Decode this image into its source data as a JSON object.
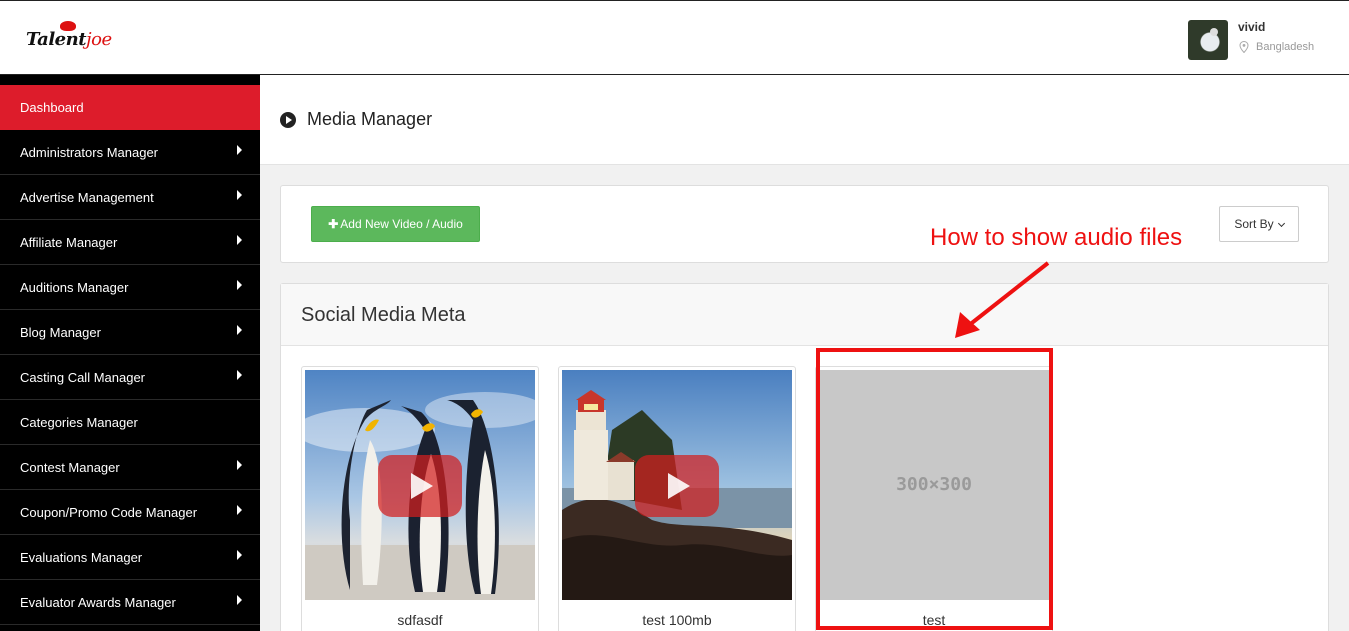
{
  "header": {
    "logo_main": "Talent",
    "logo_accent": "joe",
    "user": {
      "name": "vivid",
      "location": "Bangladesh",
      "avatar_icon": "user-avatar"
    }
  },
  "sidebar": {
    "items": [
      {
        "label": "Dashboard",
        "active": true,
        "has_submenu": false
      },
      {
        "label": "Administrators Manager",
        "has_submenu": true
      },
      {
        "label": "Advertise Management",
        "has_submenu": true
      },
      {
        "label": "Affiliate Manager",
        "has_submenu": true
      },
      {
        "label": "Auditions Manager",
        "has_submenu": true
      },
      {
        "label": "Blog Manager",
        "has_submenu": true
      },
      {
        "label": "Casting Call Manager",
        "has_submenu": true
      },
      {
        "label": "Categories Manager",
        "has_submenu": false
      },
      {
        "label": "Contest Manager",
        "has_submenu": true
      },
      {
        "label": "Coupon/Promo Code Manager",
        "has_submenu": true
      },
      {
        "label": "Evaluations Manager",
        "has_submenu": true
      },
      {
        "label": "Evaluator Awards Manager",
        "has_submenu": true
      }
    ]
  },
  "page": {
    "title": "Media Manager",
    "title_icon": "play-circle-icon"
  },
  "toolbar": {
    "add_label": "Add New Video / Audio",
    "add_icon": "plus-icon",
    "sort_label": "Sort By"
  },
  "media": {
    "title": "Social Media Meta",
    "items": [
      {
        "name": "sdfasdf",
        "type": "video",
        "thumbnail": "penguins"
      },
      {
        "name": "test 100mb",
        "type": "video",
        "thumbnail": "lighthouse"
      },
      {
        "name": "test",
        "type": "audio",
        "thumbnail": "placeholder",
        "placeholder_text": "300×300"
      }
    ]
  },
  "annotation": {
    "text": "How to show audio files",
    "color": "#ee1111"
  },
  "colors": {
    "sidebar_active": "#dd1c2b",
    "add_button": "#5cb85c",
    "sidebar_bg": "#000000"
  }
}
